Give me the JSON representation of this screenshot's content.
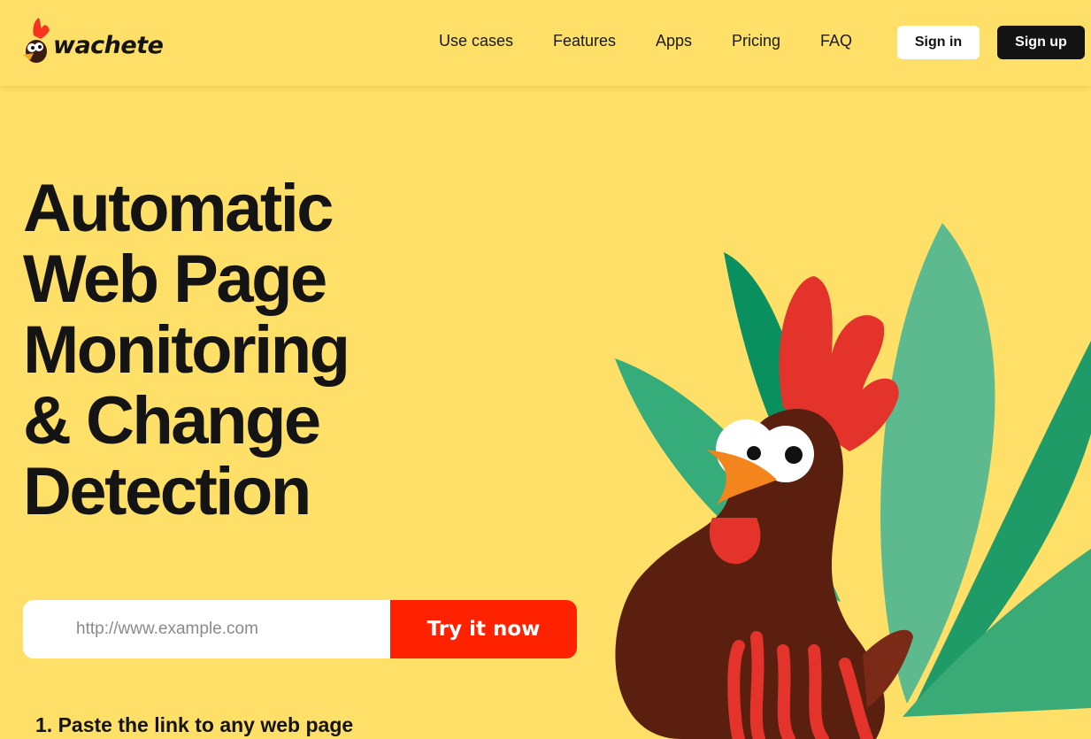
{
  "brand": {
    "name": "wachete"
  },
  "nav": {
    "items": [
      {
        "label": "Use cases"
      },
      {
        "label": "Features"
      },
      {
        "label": "Apps"
      },
      {
        "label": "Pricing"
      },
      {
        "label": "FAQ"
      }
    ],
    "sign_in": "Sign in",
    "sign_up": "Sign up"
  },
  "hero": {
    "title_lines": [
      "Automatic",
      "Web Page",
      "Monitoring",
      "& Change",
      "Detection"
    ],
    "url_placeholder": "http://www.example.com",
    "cta": "Try it now",
    "step_1": "1. Paste the link to any web page"
  },
  "colors": {
    "background": "#fedf68",
    "cta": "#ff2200",
    "dark": "#141414"
  },
  "icons": {
    "logo": "rooster-logo-icon",
    "illustration": "rooster-illustration"
  }
}
